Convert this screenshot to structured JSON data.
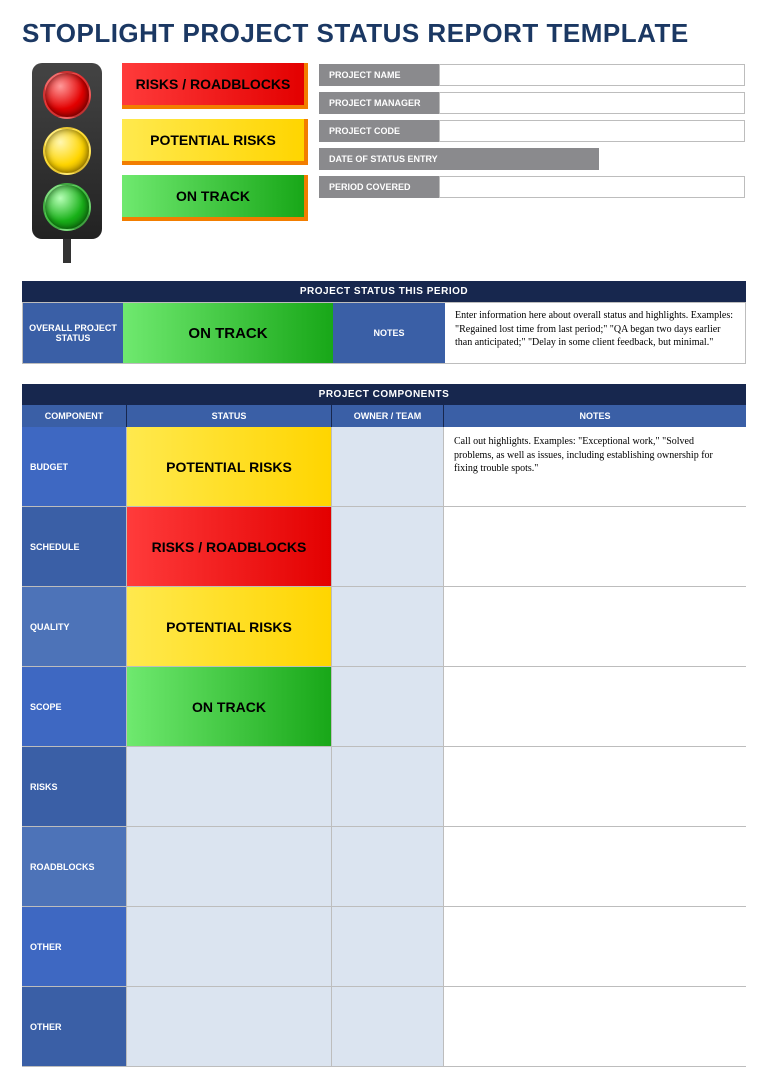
{
  "title": "STOPLIGHT PROJECT STATUS REPORT TEMPLATE",
  "legend": {
    "red": "RISKS / ROADBLOCKS",
    "yellow": "POTENTIAL RISKS",
    "green": "ON TRACK"
  },
  "project_info": [
    {
      "label": "PROJECT NAME",
      "value": "",
      "wide": false
    },
    {
      "label": "PROJECT MANAGER",
      "value": "",
      "wide": false
    },
    {
      "label": "PROJECT CODE",
      "value": "",
      "wide": false
    },
    {
      "label": "DATE OF STATUS ENTRY",
      "value": "",
      "wide": true
    },
    {
      "label": "PERIOD COVERED",
      "value": "",
      "wide": false
    }
  ],
  "status_period": {
    "banner": "PROJECT STATUS THIS PERIOD",
    "overall_label": "OVERALL PROJECT STATUS",
    "overall_status": "ON TRACK",
    "overall_status_level": "green",
    "notes_label": "NOTES",
    "notes_text": "Enter information here about overall status and highlights. Examples: \"Regained lost time from last period;\" \"QA began two days earlier than anticipated;\" \"Delay in some client feedback, but minimal.\""
  },
  "components": {
    "banner": "PROJECT COMPONENTS",
    "headers": {
      "component": "COMPONENT",
      "status": "STATUS",
      "owner": "OWNER / TEAM",
      "notes": "NOTES"
    },
    "rows": [
      {
        "component": "BUDGET",
        "status": "POTENTIAL RISKS",
        "level": "yellow",
        "owner": "",
        "notes": "Call out highlights. Examples: \"Exceptional work,\" \"Solved problems, as well as issues, including establishing ownership for fixing trouble spots.\""
      },
      {
        "component": "SCHEDULE",
        "status": "RISKS / ROADBLOCKS",
        "level": "red",
        "owner": "",
        "notes": ""
      },
      {
        "component": "QUALITY",
        "status": "POTENTIAL RISKS",
        "level": "yellow",
        "owner": "",
        "notes": ""
      },
      {
        "component": "SCOPE",
        "status": "ON TRACK",
        "level": "green",
        "owner": "",
        "notes": ""
      },
      {
        "component": "RISKS",
        "status": "",
        "level": "",
        "owner": "",
        "notes": ""
      },
      {
        "component": "ROADBLOCKS",
        "status": "",
        "level": "",
        "owner": "",
        "notes": ""
      },
      {
        "component": "OTHER",
        "status": "",
        "level": "",
        "owner": "",
        "notes": ""
      },
      {
        "component": "OTHER",
        "status": "",
        "level": "",
        "owner": "",
        "notes": ""
      }
    ]
  }
}
